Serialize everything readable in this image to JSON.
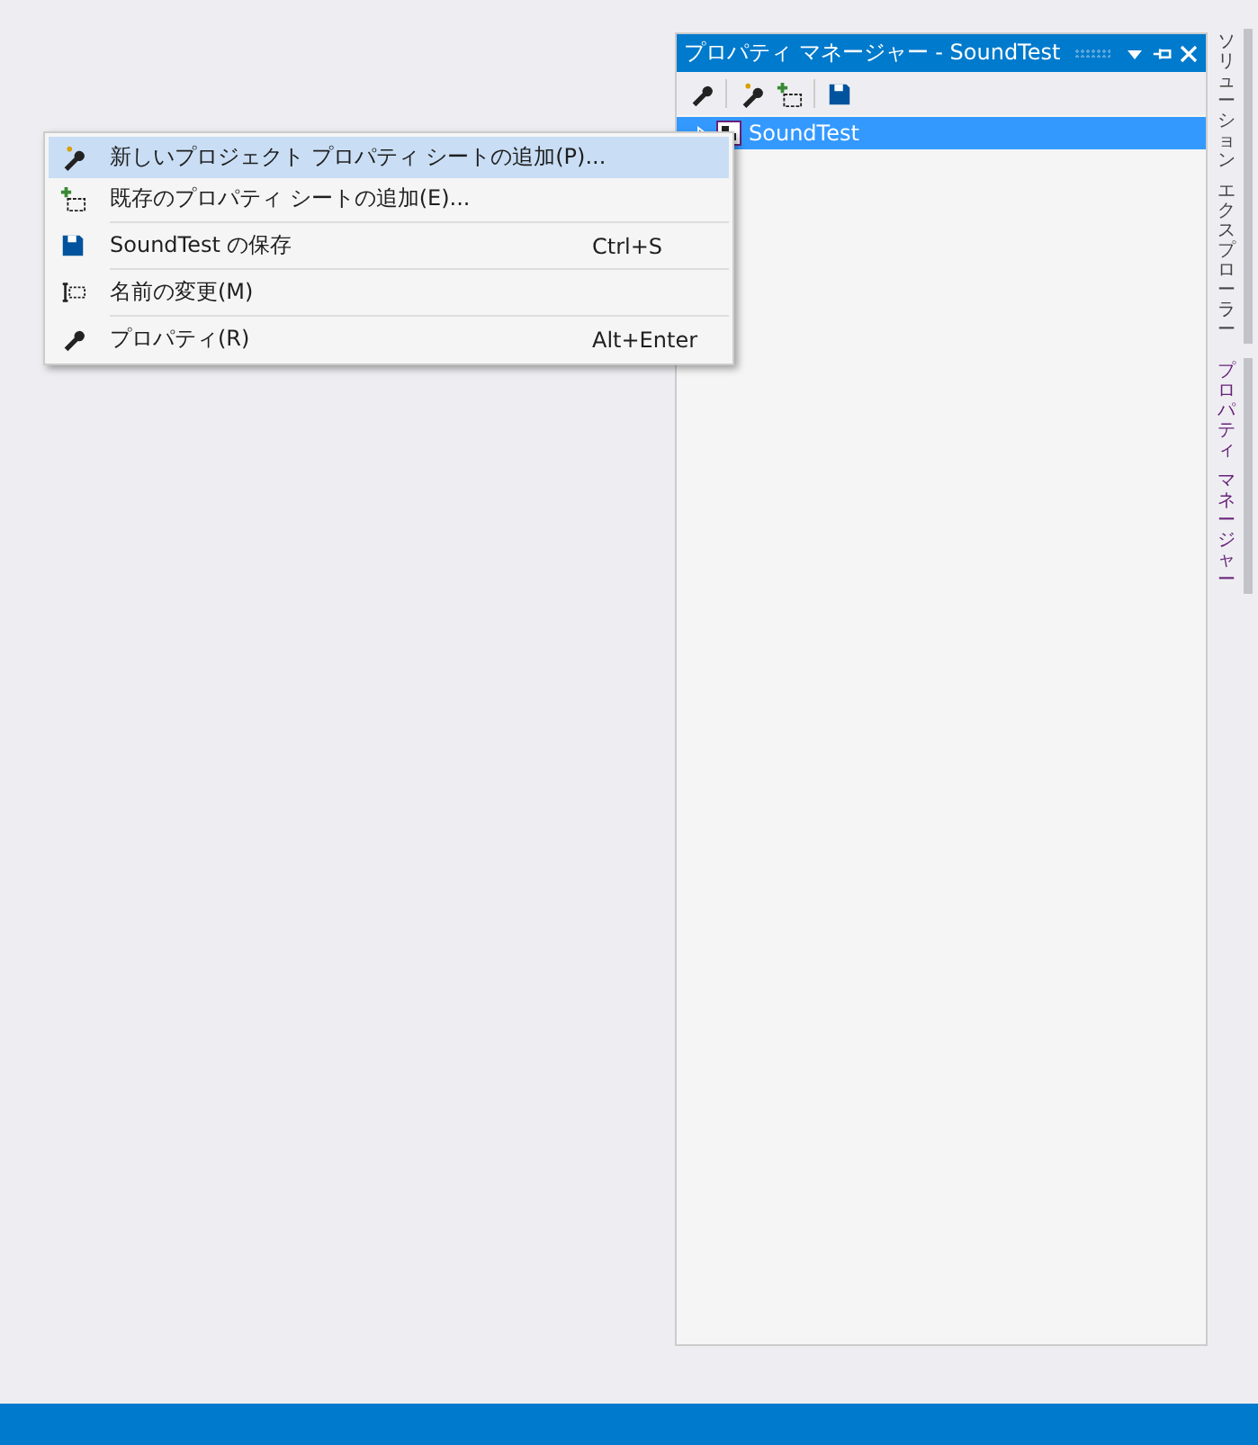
{
  "panel": {
    "title": "プロパティ マネージャー - SoundTest",
    "tree": [
      {
        "label": "SoundTest",
        "selected": true,
        "expanded": false
      }
    ]
  },
  "side_tabs": [
    {
      "words": [
        "ソリューション",
        "エクスプローラー"
      ],
      "selected": false
    },
    {
      "words": [
        "プロパティ",
        "マネージャー"
      ],
      "selected": true
    }
  ],
  "context_menu": [
    {
      "label": "新しいプロジェクト プロパティ シートの追加(P)...",
      "selected": true,
      "separator_before": false
    },
    {
      "label": "既存のプロパティ シートの追加(E)...",
      "selected": false,
      "separator_before": false
    },
    {
      "label": "SoundTest の保存",
      "shortcut": "Ctrl+S",
      "selected": false,
      "separator_before": true
    },
    {
      "label": "名前の変更(M)",
      "selected": false,
      "separator_before": true
    },
    {
      "label": "プロパティ(R)",
      "shortcut": "Alt+Enter",
      "selected": false,
      "separator_before": true
    }
  ]
}
